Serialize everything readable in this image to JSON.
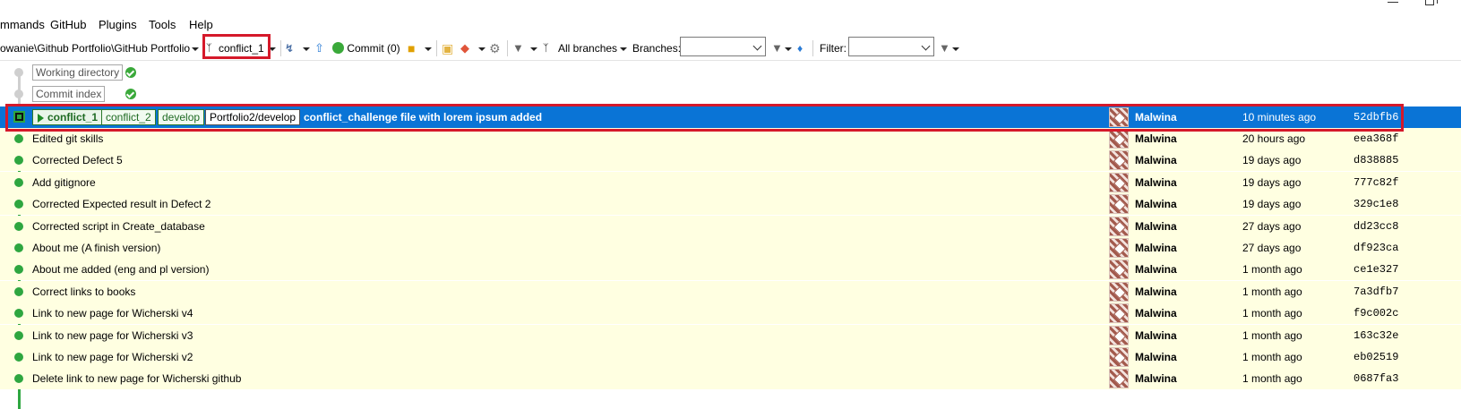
{
  "menu": {
    "items": [
      "mmands",
      "GitHub",
      "Plugins",
      "Tools",
      "Help"
    ]
  },
  "toolbar": {
    "repo_path": "owanie\\Github Portfolio\\GitHub Portfolio",
    "current_branch": "conflict_1",
    "commit_label": "Commit (0)",
    "all_branches_label": "All branches",
    "branches_label": "Branches:",
    "branches_value": "",
    "filter_label": "Filter:",
    "filter_value": ""
  },
  "grid": {
    "working_directory": "Working directory",
    "commit_index": "Commit index",
    "selected": {
      "refs": {
        "head": "conflict_1",
        "branch1": "conflict_2",
        "branch2": "develop",
        "remote": "Portfolio2/develop"
      },
      "message": "conflict_challenge file with lorem ipsum added",
      "author": "Malwina",
      "date": "10 minutes ago",
      "hash": "52dbfb6"
    },
    "commits": [
      {
        "message": "Edited git skills",
        "author": "Malwina",
        "date": "20 hours ago",
        "hash": "eea368f"
      },
      {
        "message": "Corrected Defect 5",
        "author": "Malwina",
        "date": "19 days ago",
        "hash": "d838885"
      },
      {
        "message": "Add gitignore",
        "author": "Malwina",
        "date": "19 days ago",
        "hash": "777c82f"
      },
      {
        "message": "Corrected Expected result in Defect 2",
        "author": "Malwina",
        "date": "19 days ago",
        "hash": "329c1e8"
      },
      {
        "message": "Corrected script in Create_database",
        "author": "Malwina",
        "date": "27 days ago",
        "hash": "dd23cc8"
      },
      {
        "message": "About me (A finish version)",
        "author": "Malwina",
        "date": "27 days ago",
        "hash": "df923ca"
      },
      {
        "message": "About me added (eng and pl version)",
        "author": "Malwina",
        "date": "1 month ago",
        "hash": "ce1e327"
      },
      {
        "message": "Correct links to books",
        "author": "Malwina",
        "date": "1 month ago",
        "hash": "7a3dfb7"
      },
      {
        "message": "Link to new page for Wicherski v4",
        "author": "Malwina",
        "date": "1 month ago",
        "hash": "f9c002c"
      },
      {
        "message": "Link to new page for Wicherski v3",
        "author": "Malwina",
        "date": "1 month ago",
        "hash": "163c32e"
      },
      {
        "message": "Link to new page for Wicherski v2",
        "author": "Malwina",
        "date": "1 month ago",
        "hash": "eb02519"
      },
      {
        "message": "Delete link to new page for Wicherski github",
        "author": "Malwina",
        "date": "1 month ago",
        "hash": "0687fa3"
      }
    ]
  },
  "colors": {
    "selected_row": "#0a74d6",
    "commit_row": "#ffffe1",
    "graph": "#2ea640",
    "highlight_border": "#d5192a"
  },
  "icons": [
    "branch-icon",
    "pull-icon",
    "push-icon",
    "commit-check-icon",
    "stash-icon",
    "folder-icon",
    "git-icon",
    "settings-icon",
    "filter-icon",
    "branch-filter-icon"
  ]
}
